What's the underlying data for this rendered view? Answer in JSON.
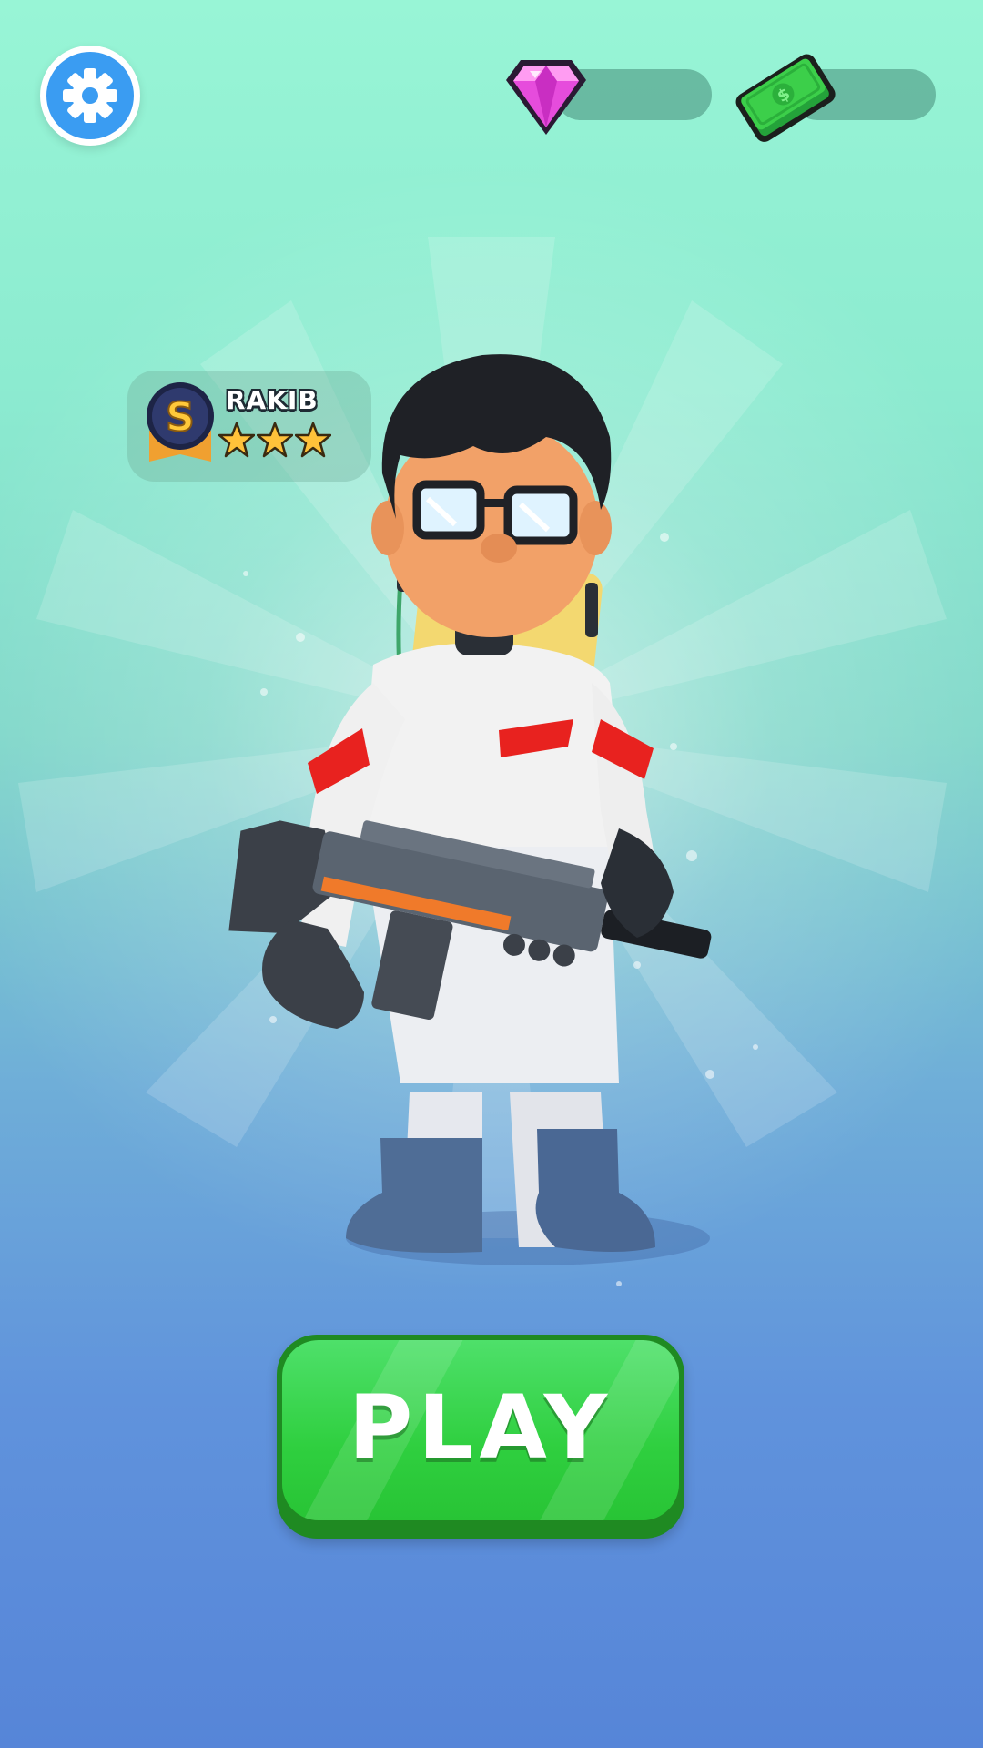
{
  "header": {
    "settings_icon": "gear-icon",
    "currencies": [
      {
        "name": "gems",
        "icon": "gem-icon",
        "color": "#e64cdc",
        "amount": ""
      },
      {
        "name": "cash",
        "icon": "cash-icon",
        "color": "#3ccf4a",
        "amount": ""
      }
    ]
  },
  "player": {
    "name": "RAKIB",
    "rank_icon": "rank-s-badge-icon",
    "rank_letter": "S",
    "stars": 3,
    "stars_max": 3
  },
  "character": {
    "icon": "character-with-rifle",
    "description_colors": {
      "suit": "#f2f2f2",
      "stripe": "#e8221f",
      "boots": "#4f6d96",
      "gun": "#5a6470",
      "gun_accent": "#f07a2a"
    }
  },
  "actions": {
    "play_label": "PLAY",
    "play_color": "#2fcf3f"
  }
}
